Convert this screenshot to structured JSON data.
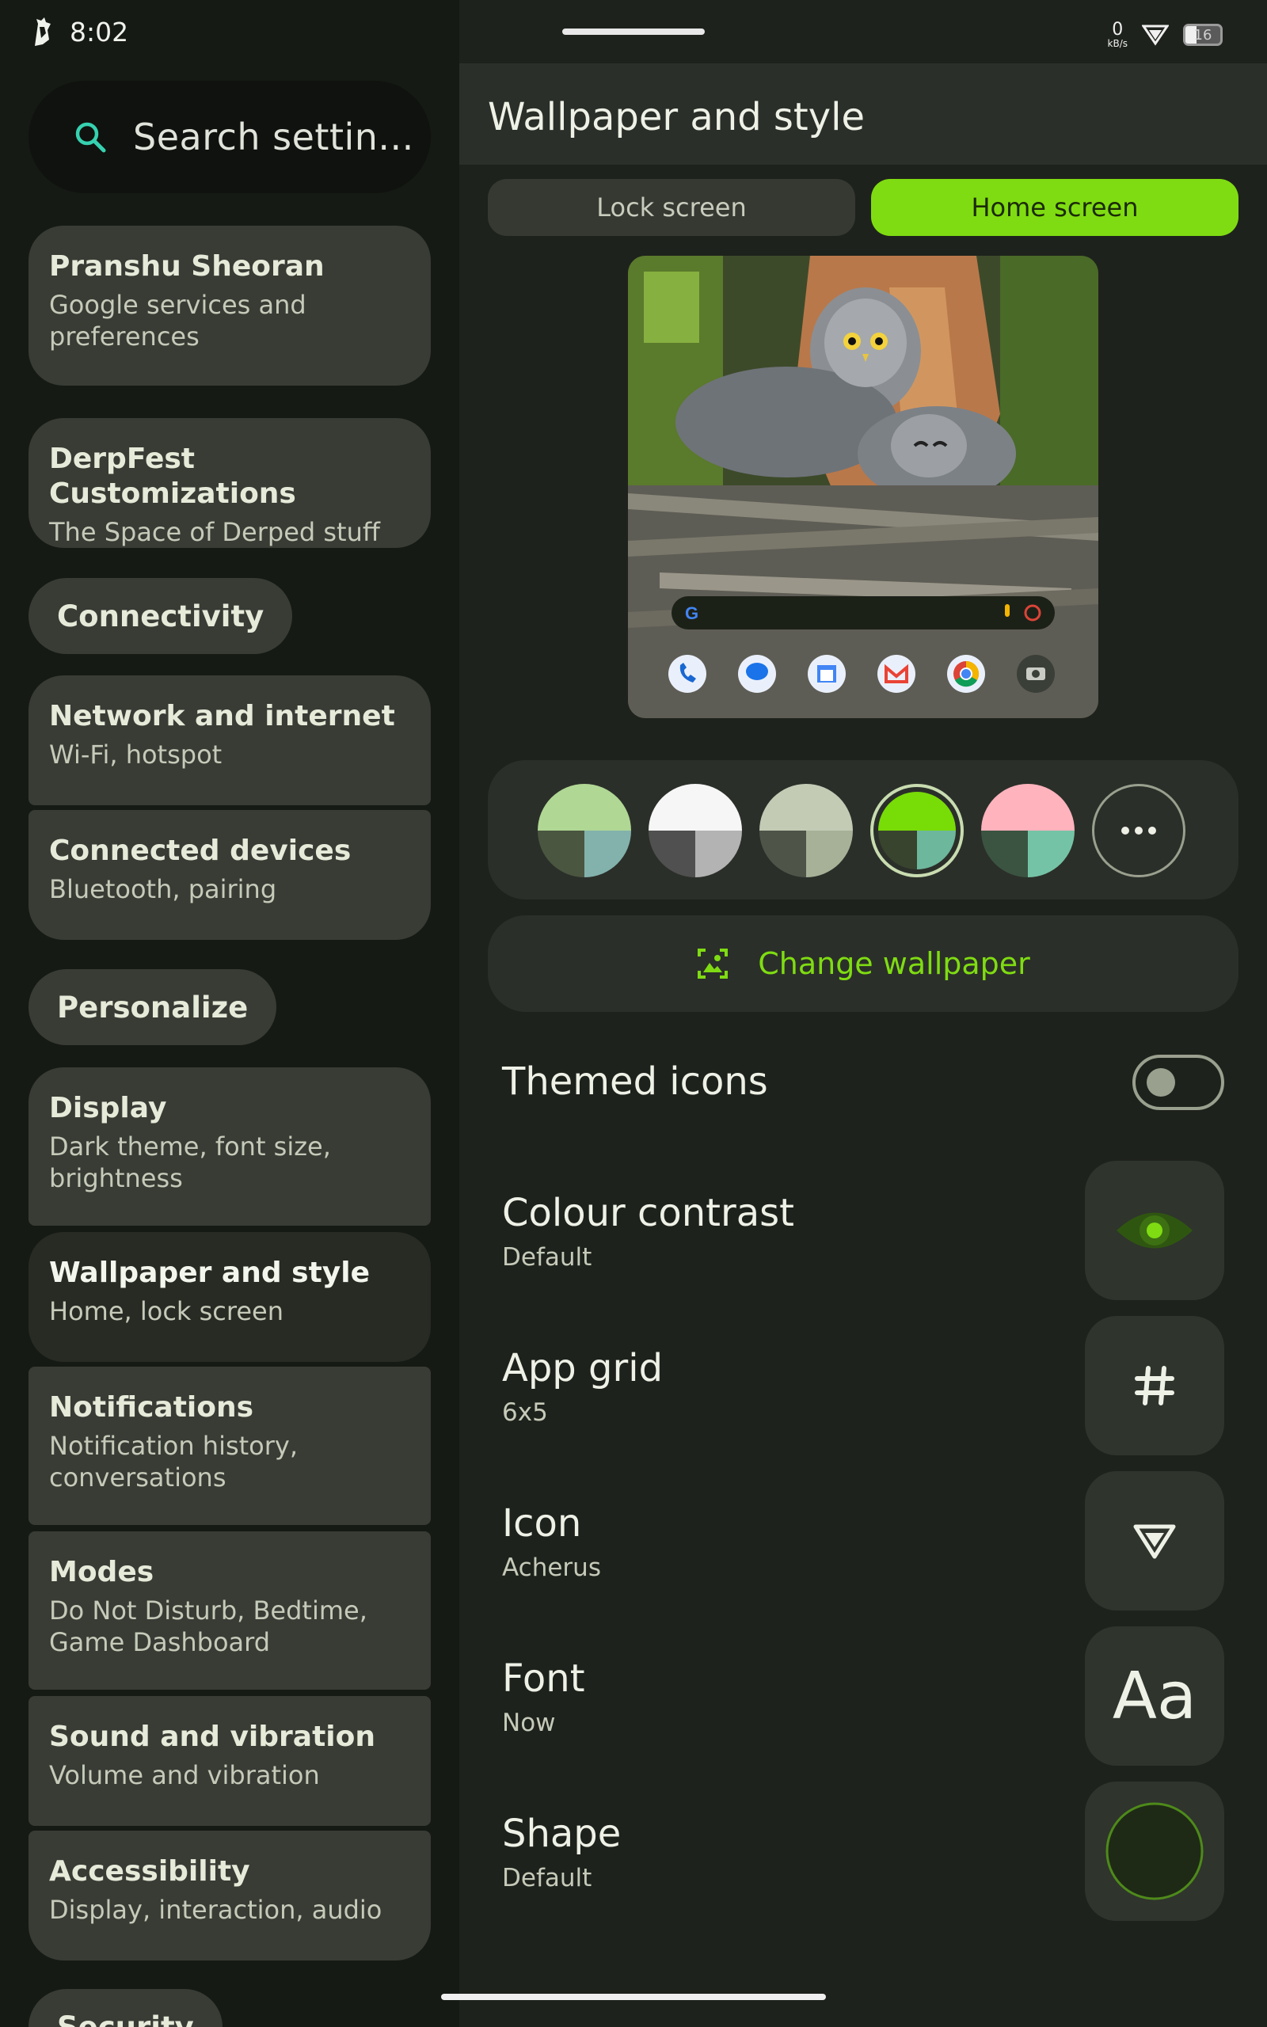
{
  "status_bar": {
    "time": "8:02",
    "net_speed_value": "0",
    "net_speed_unit": "kB/s",
    "battery": "16"
  },
  "search": {
    "placeholder": "Search settin..."
  },
  "sidebar": {
    "items": [
      {
        "title": "Pranshu Sheoran",
        "subtitle": "Google services and preferences"
      },
      {
        "title": "DerpFest Customizations",
        "subtitle": "The Space of Derped stuff"
      },
      {
        "section": "Connectivity"
      },
      {
        "title": "Network and internet",
        "subtitle": "Wi-Fi, hotspot"
      },
      {
        "title": "Connected devices",
        "subtitle": "Bluetooth, pairing"
      },
      {
        "section": "Personalize"
      },
      {
        "title": "Display",
        "subtitle": "Dark theme, font size, brightness"
      },
      {
        "title": "Wallpaper and style",
        "subtitle": "Home, lock screen",
        "active": true
      },
      {
        "title": "Notifications",
        "subtitle": "Notification history, conversations"
      },
      {
        "title": "Modes",
        "subtitle": "Do Not Disturb, Bedtime, Game Dashboard"
      },
      {
        "title": "Sound and vibration",
        "subtitle": "Volume and vibration"
      },
      {
        "title": "Accessibility",
        "subtitle": "Display, interaction, audio"
      },
      {
        "section": "Security"
      }
    ]
  },
  "main": {
    "title": "Wallpaper and style",
    "tabs": [
      {
        "label": "Lock screen",
        "selected": false
      },
      {
        "label": "Home screen",
        "selected": true
      }
    ],
    "palettes": [
      {
        "top": "#b0d794",
        "bottom_left": "#4a5640",
        "bottom_right": "#83b2ac",
        "selected": false
      },
      {
        "top": "#f6f6f6",
        "bottom_left": "#505050",
        "bottom_right": "#b3b3b3",
        "selected": false
      },
      {
        "top": "#c3cbb5",
        "bottom_left": "#4f5449",
        "bottom_right": "#a7b197",
        "selected": false
      },
      {
        "top": "#78dc07",
        "bottom_left": "#38442e",
        "bottom_right": "#6db79c",
        "selected": true
      },
      {
        "top": "#ffb3bd",
        "bottom_left": "#3b5441",
        "bottom_right": "#75c3a6",
        "selected": false
      }
    ],
    "more_colors_icon": "more-horiz-icon",
    "change_wallpaper_label": "Change wallpaper",
    "themed_icons": {
      "label": "Themed icons",
      "enabled": false
    },
    "settings": [
      {
        "title": "Colour contrast",
        "value": "Default",
        "icon": "eye-icon"
      },
      {
        "title": "App grid",
        "value": "6x5",
        "icon": "hash-icon"
      },
      {
        "title": "Icon",
        "value": "Acherus",
        "icon": "shield-icon"
      },
      {
        "title": "Font",
        "value": "Now",
        "icon_text": "Aa"
      },
      {
        "title": "Shape",
        "value": "Default",
        "icon": "circle-shape-icon"
      }
    ]
  },
  "colors": {
    "accent": "#7fdc12",
    "background": "#161a14",
    "surface": "#383c35"
  }
}
